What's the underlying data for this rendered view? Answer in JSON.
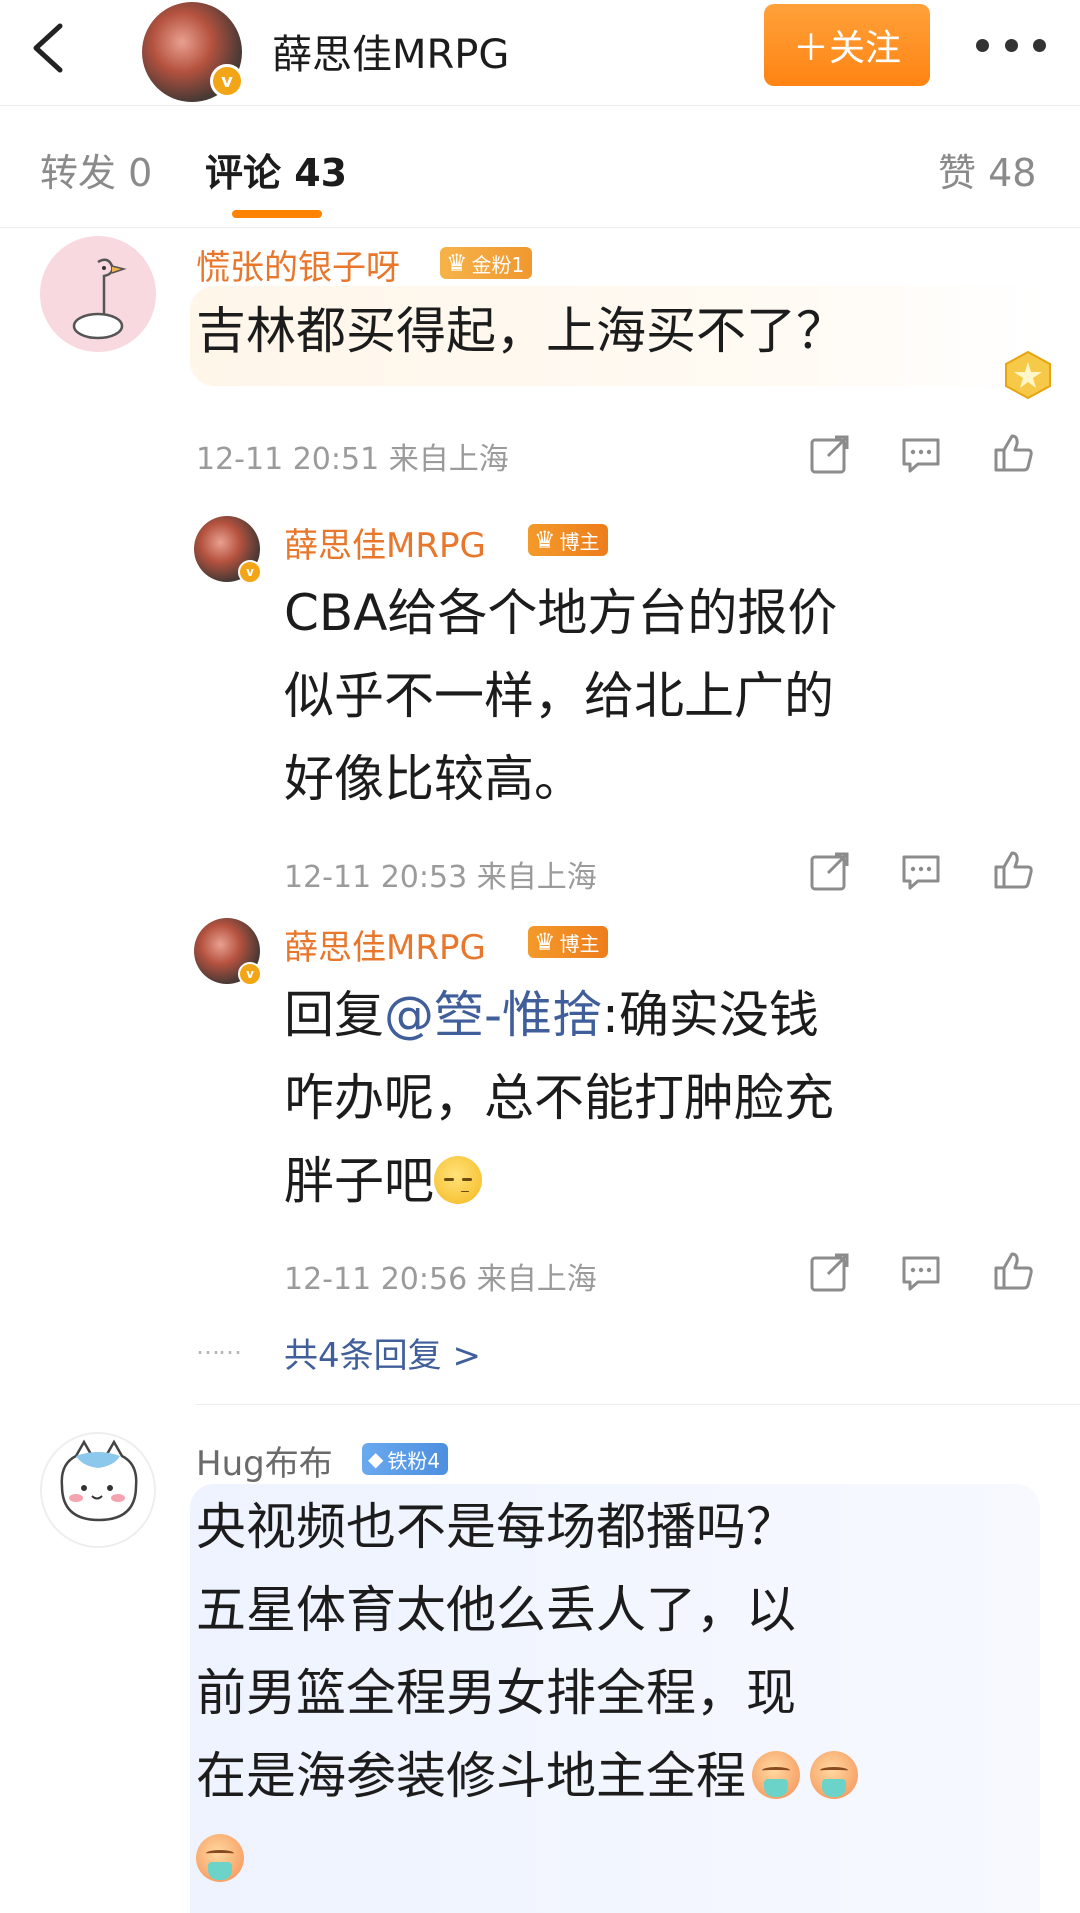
{
  "header": {
    "name": "薛思佳MRPG",
    "follow_label": "＋关注"
  },
  "tabs": [
    {
      "label": "转发 0"
    },
    {
      "label": "评论 43"
    },
    {
      "label": "赞 48"
    }
  ],
  "colors": {
    "accent": "#ff8200",
    "username_orange": "#e8762b",
    "mention_blue": "#3f5e9a",
    "meta_gray": "#9b9b9b"
  },
  "comments": [
    {
      "username": "慌张的银子呀",
      "badge": "金粉1",
      "content": "吉林都买得起，上海买不了？",
      "time": "12-11 20:51 来自上海"
    },
    {
      "username": "Hug布布",
      "badge": "铁粉4",
      "content_lines": [
        "央视频也不是每场都播吗？",
        "五星体育太他么丢人了，以",
        "前男篮全程男女排全程，现",
        "在是海参装修斗地主全程"
      ]
    }
  ],
  "replies": [
    {
      "username": "薛思佳MRPG",
      "badge": "博主",
      "content_lines": [
        "CBA给各个地方台的报价",
        "似乎不一样，给北上广的",
        "好像比较高。"
      ],
      "time": "12-11 20:53 来自上海"
    },
    {
      "username": "薛思佳MRPG",
      "badge": "博主",
      "reply_prefix": "回复",
      "mention": "@箜-惟捨",
      "content_lines": [
        ":确实没钱",
        "咋办呢，总不能打肿脸充",
        "胖子吧"
      ],
      "time": "12-11 20:56 来自上海"
    }
  ],
  "more_replies": {
    "dots": "……",
    "label": "共4条回复 >"
  },
  "icons": [
    "back-icon",
    "verified-icon",
    "more-icon",
    "share-icon",
    "comment-icon",
    "like-icon",
    "crown-icon",
    "diamond-icon",
    "sleepy-emoji-icon",
    "puke-emoji-icon"
  ]
}
